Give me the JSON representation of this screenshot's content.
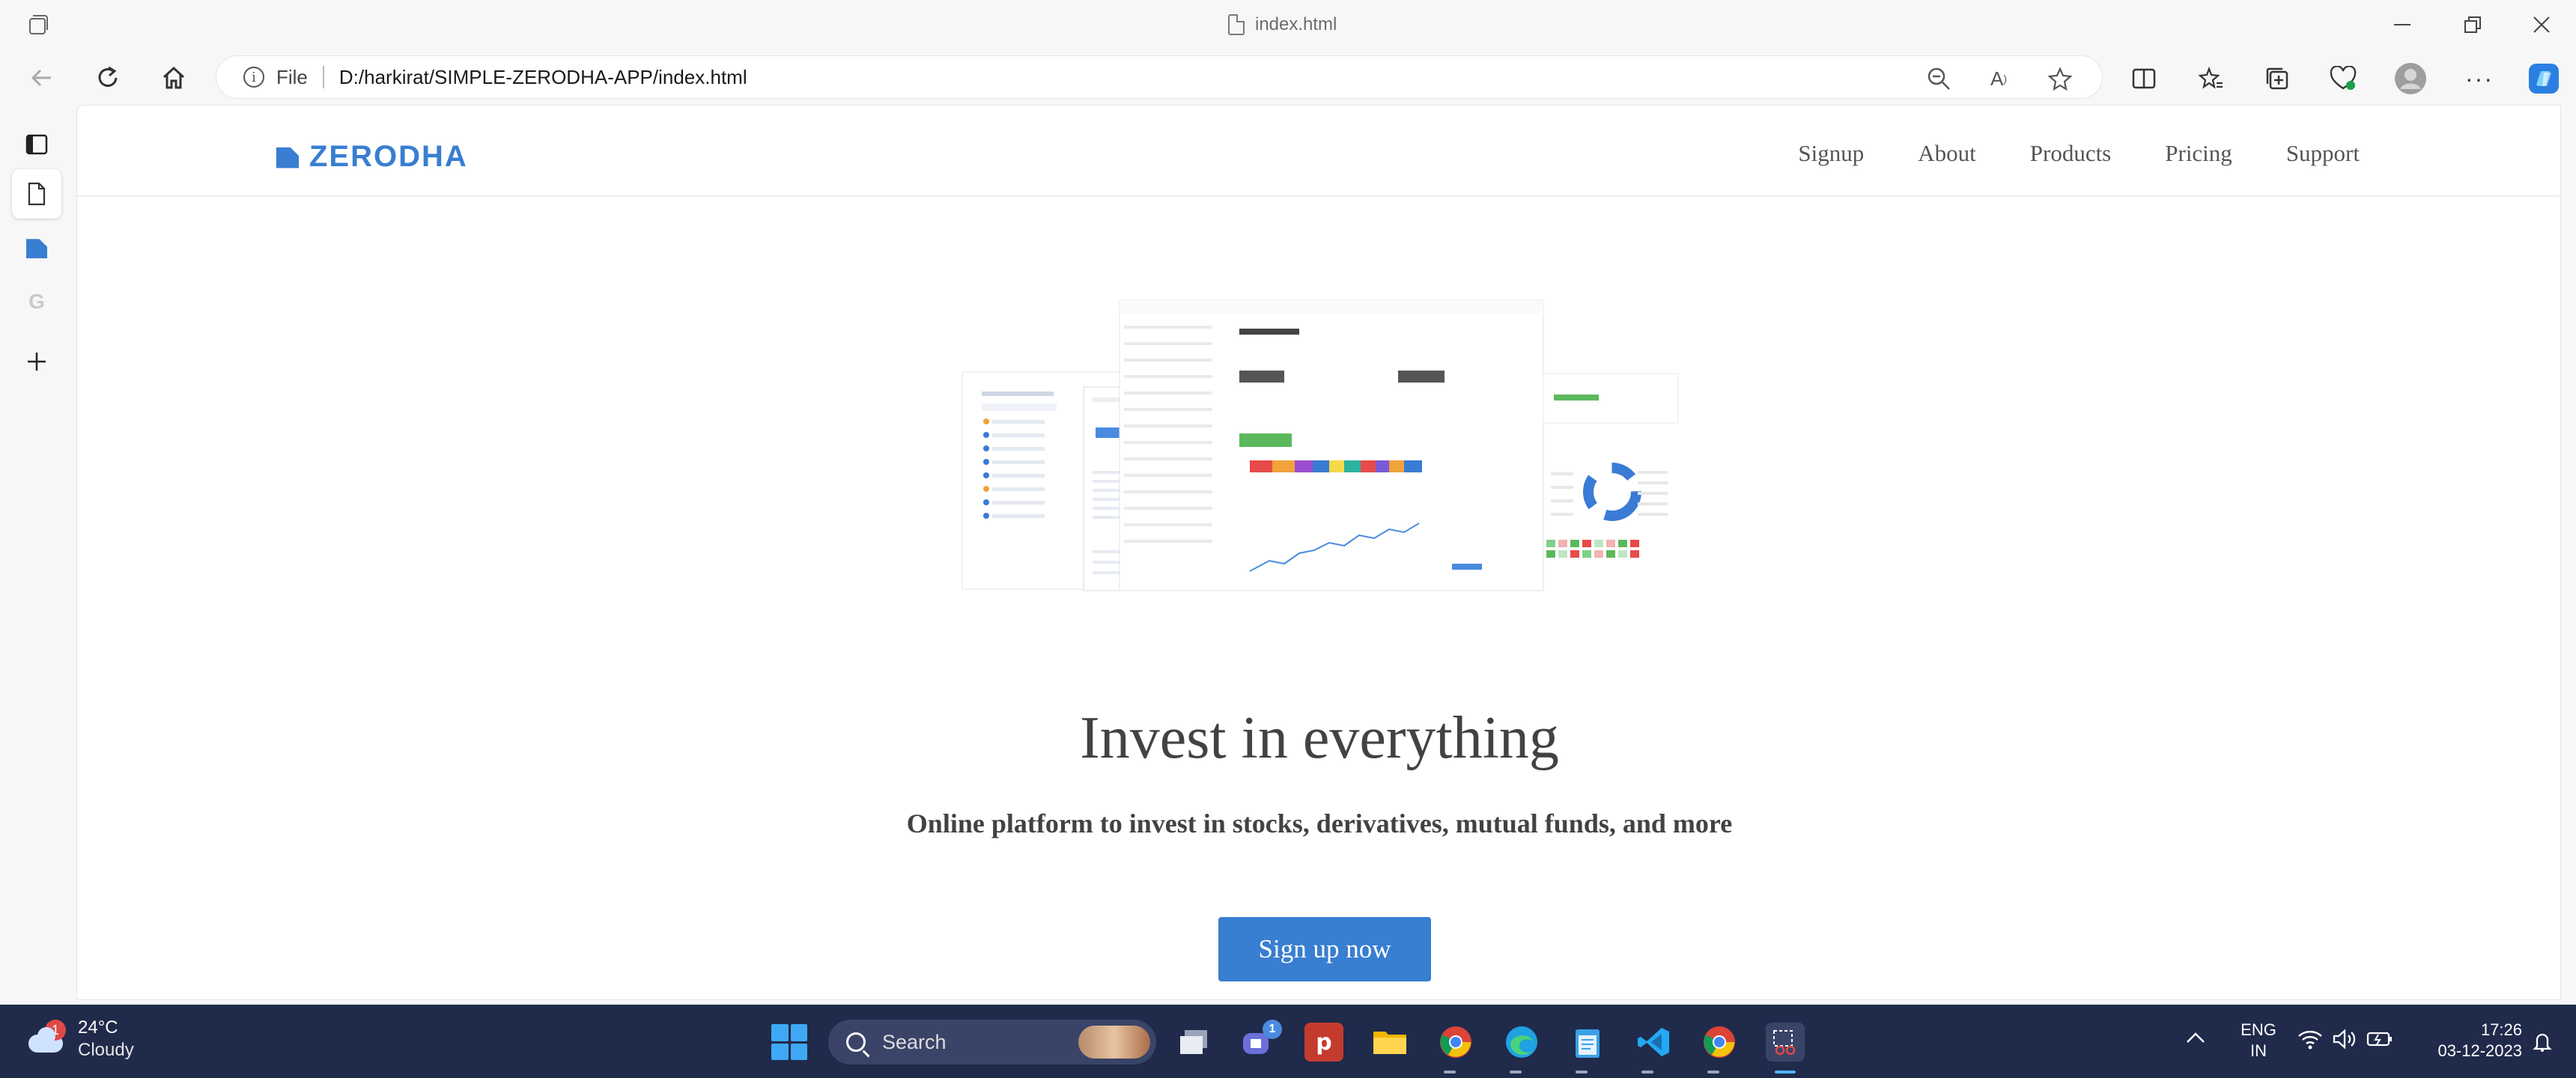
{
  "browser": {
    "tab_title": "index.html",
    "address_prefix": "File",
    "address_url": "D:/harkirat/SIMPLE-ZERODHA-APP/index.html"
  },
  "site": {
    "logo_text": "ZERODHA",
    "nav": [
      "Signup",
      "About",
      "Products",
      "Pricing",
      "Support"
    ],
    "hero": {
      "title": "Invest in everything",
      "subtitle": "Online platform to invest in stocks, derivatives, mutual funds, and more",
      "cta": "Sign up now"
    }
  },
  "taskbar": {
    "weather_temp": "24°C",
    "weather_cond": "Cloudy",
    "weather_badge": "1",
    "search_label": "Search",
    "teams_badge": "1",
    "lang_line1": "ENG",
    "lang_line2": "IN",
    "time": "17:26",
    "date": "03-12-2023"
  },
  "colors": {
    "brand": "#387ed1",
    "taskbar": "#202a4a"
  }
}
